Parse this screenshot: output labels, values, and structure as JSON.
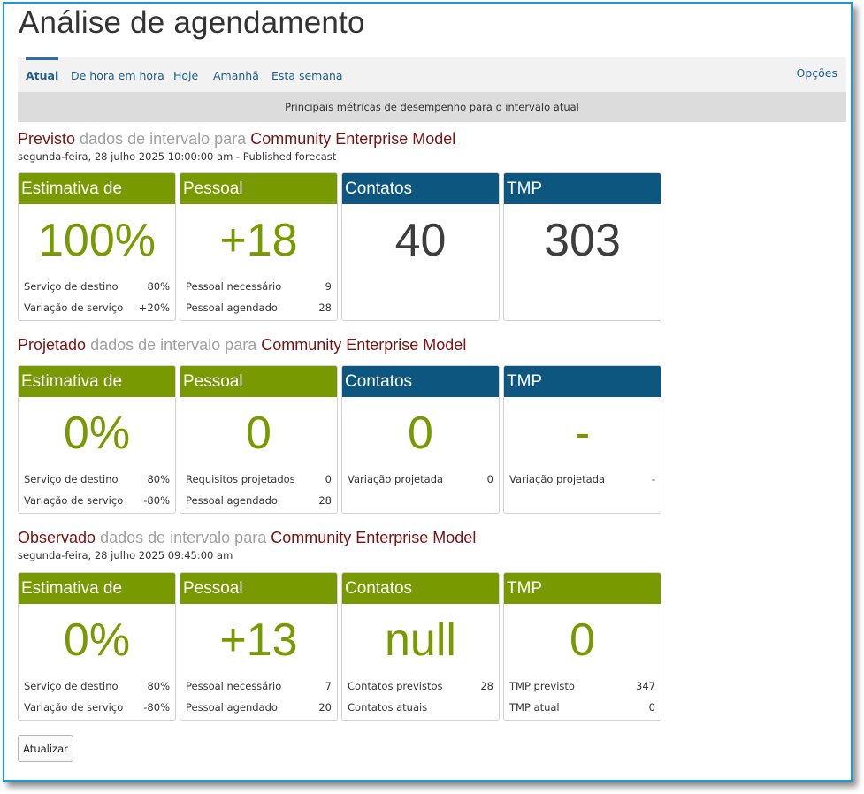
{
  "page": {
    "title": "Análise de agendamento"
  },
  "tabs": [
    "Atual",
    "De hora em hora",
    "Hoje",
    "Amanhã",
    "Esta semana"
  ],
  "options_label": "Opções",
  "subheader": "Principais métricas de desempenho para o intervalo atual",
  "sections": [
    {
      "kind": "Previsto",
      "middle": "dados de intervalo para",
      "model": "Community Enterprise Model",
      "date": "segunda-feira, 28 julho 2025 10:00:00 am - Published forecast",
      "cards": [
        {
          "title": "Estimativa de",
          "value": "100%",
          "rows": [
            {
              "label": "Serviço de destino",
              "value": "80%"
            },
            {
              "label": "Variação de serviço",
              "value": "+20%"
            }
          ]
        },
        {
          "title": "Pessoal",
          "value": "+18",
          "rows": [
            {
              "label": "Pessoal necessário",
              "value": "9"
            },
            {
              "label": "Pessoal agendado",
              "value": "28"
            }
          ]
        },
        {
          "title": "Contatos",
          "value": "40",
          "rows": []
        },
        {
          "title": "TMP",
          "value": "303",
          "rows": []
        }
      ]
    },
    {
      "kind": "Projetado",
      "middle": "dados de intervalo para",
      "model": "Community Enterprise Model",
      "date": "",
      "cards": [
        {
          "title": "Estimativa de",
          "value": "0%",
          "rows": [
            {
              "label": "Serviço de destino",
              "value": "80%"
            },
            {
              "label": "Variação de serviço",
              "value": "-80%"
            }
          ]
        },
        {
          "title": "Pessoal",
          "value": "0",
          "rows": [
            {
              "label": "Requisitos projetados",
              "value": "0"
            },
            {
              "label": "Pessoal agendado",
              "value": "28"
            }
          ]
        },
        {
          "title": "Contatos",
          "value": "0",
          "rows": [
            {
              "label": "Variação projetada",
              "value": "0"
            }
          ]
        },
        {
          "title": "TMP",
          "value": "-",
          "rows": [
            {
              "label": "Variação projetada",
              "value": "-"
            }
          ]
        }
      ]
    },
    {
      "kind": "Observado",
      "middle": "dados de intervalo para",
      "model": "Community Enterprise Model",
      "date": "segunda-feira, 28 julho 2025 09:45:00 am",
      "cards": [
        {
          "title": "Estimativa de",
          "value": "0%",
          "rows": [
            {
              "label": "Serviço de destino",
              "value": "80%"
            },
            {
              "label": "Variação de serviço",
              "value": "-80%"
            }
          ]
        },
        {
          "title": "Pessoal",
          "value": "+13",
          "rows": [
            {
              "label": "Pessoal necessário",
              "value": "7"
            },
            {
              "label": "Pessoal agendado",
              "value": "20"
            }
          ]
        },
        {
          "title": "Contatos",
          "value": "null",
          "rows": [
            {
              "label": "Contatos previstos",
              "value": "28"
            },
            {
              "label": "Contatos atuais",
              "value": ""
            }
          ]
        },
        {
          "title": "TMP",
          "value": "0",
          "rows": [
            {
              "label": "TMP previsto",
              "value": "347"
            },
            {
              "label": "TMP atual",
              "value": "0"
            }
          ]
        }
      ]
    }
  ],
  "refresh_label": "Atualizar",
  "colors": {
    "green": "#789a00",
    "blue": "#0d5680",
    "model_red": "#7a1212",
    "muted_gray": "#a0a0a0",
    "link_blue": "#1f5e8f",
    "frame_border": "#1a9bd7"
  }
}
